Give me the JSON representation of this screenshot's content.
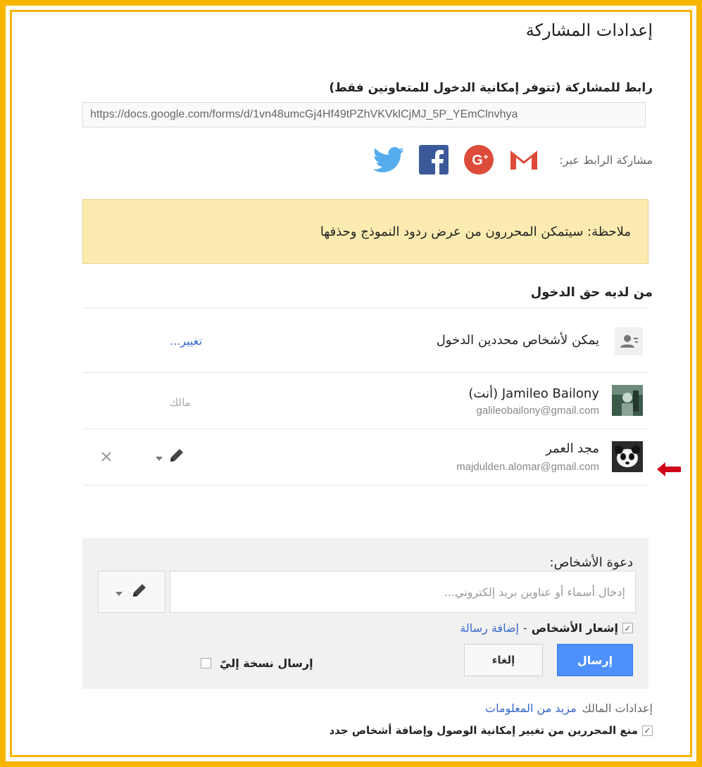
{
  "dialog": {
    "title": "إعدادات المشاركة",
    "share_link_label": "رابط للمشاركة (تتوفر إمكانية الدخول للمتعاونين فقط)",
    "share_link_url": "https://docs.google.com/forms/d/1vn48umcGj4Hf49tPZhVKVklCjMJ_5P_YEmClnvhya",
    "share_via_label": "مشاركة الرابط عبر:",
    "share_services": [
      "gmail-icon",
      "google-plus-icon",
      "facebook-icon",
      "twitter-icon"
    ],
    "note": "ملاحظة: سيتمكن المحررون من عرض ردود النموذج وحذفها"
  },
  "access": {
    "heading": "من لديه حق الدخول",
    "restricted": {
      "text": "يمكن لأشخاص محددين الدخول",
      "change_link": "تغيير..."
    },
    "owner": {
      "name": "Jamileo Bailony (أنت)",
      "email": "galileobailony@gmail.com",
      "role": "مالك"
    },
    "editor": {
      "name": "مجد العمر",
      "email": "majdulden.alomar@gmail.com"
    }
  },
  "invite": {
    "label": "دعوة الأشخاص:",
    "placeholder": "إدخال أسماء أو عناوين بريد إلكتروني...",
    "notify_label": "إشعار الأشخاص",
    "notify_checked": true,
    "add_message": "إضافة رسالة",
    "send_button": "إرسال",
    "cancel_button": "إلغاء",
    "copy_to_me": "إرسال نسخة إليّ",
    "copy_checked": false
  },
  "owner_settings": {
    "label": "إعدادات المالك",
    "more_info": "مزيد من المعلومات",
    "prevent_editors": "منع المحررين من تغيير إمكانية الوصول وإضافة أشخاص جدد",
    "prevent_checked": true
  },
  "colors": {
    "frame": "#f7b500",
    "note_bg": "#fcebb0",
    "link": "#3366cc",
    "send_button": "#4d90fe",
    "arrow": "#d0021b"
  }
}
